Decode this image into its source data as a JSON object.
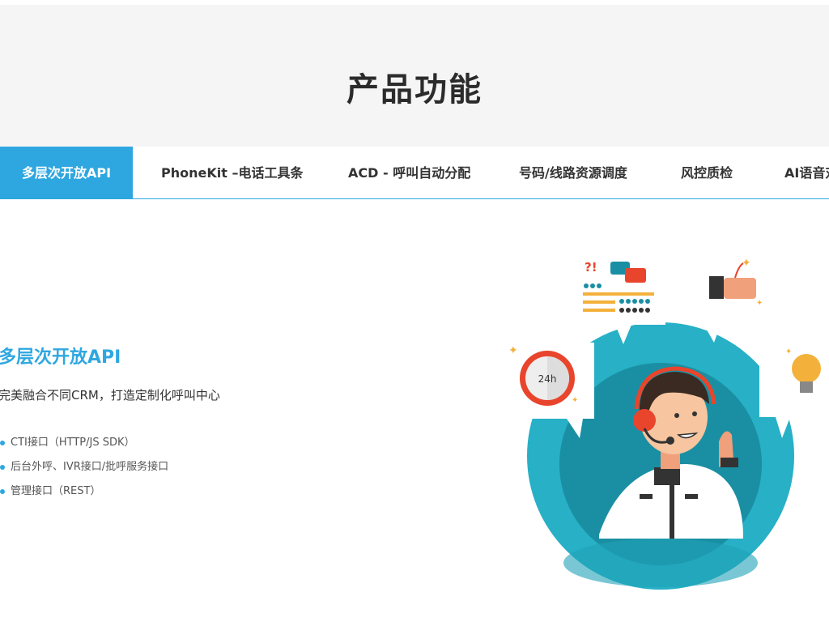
{
  "hero": {
    "title": "产品功能"
  },
  "tabs": [
    {
      "label": "多层次开放API",
      "active": true
    },
    {
      "label": "PhoneKit –电话工具条",
      "active": false
    },
    {
      "label": "ACD - 呼叫自动分配",
      "active": false
    },
    {
      "label": "号码/线路资源调度",
      "active": false
    },
    {
      "label": "风控质检",
      "active": false
    },
    {
      "label": "AI语音对",
      "active": false
    }
  ],
  "feature": {
    "title": "多层次开放API",
    "description": "完美融合不同CRM，打造定制化呼叫中心",
    "items": [
      "CTI接口（HTTP/JS SDK）",
      "后台外呼、IVR接口/批呼服务接口",
      "管理接口（REST）"
    ]
  },
  "illustration": {
    "clock_label": "24h",
    "chat_marks": "?!"
  },
  "colors": {
    "accent": "#2ea7e0",
    "hero_bg": "#f5f5f5",
    "teal_dark": "#1a8fa3",
    "teal_light": "#27b0c6"
  }
}
